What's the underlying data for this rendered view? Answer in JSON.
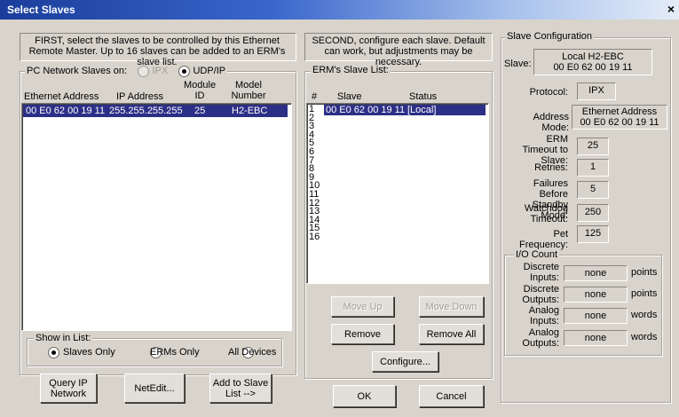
{
  "window": {
    "title": "Select Slaves",
    "close": "×"
  },
  "left": {
    "instructions": "FIRST, select the slaves to be controlled by this Ethernet Remote Master.  Up to 16 slaves can be added to an ERM's slave list.",
    "group_label": "PC Network Slaves on:",
    "radio_ipx": "IPX",
    "radio_udp": "UDP/IP",
    "columns": {
      "eth": "Ethernet Address",
      "ip": "IP Address",
      "module": "Module\nID",
      "model": "Model\nNumber"
    },
    "rows": [
      {
        "eth": "00 E0 62 00 19 11",
        "ip": "255.255.255.255",
        "module": "25",
        "model": "H2-EBC"
      }
    ],
    "show_group": "Show in List:",
    "show_options": [
      "Slaves Only",
      "ERMs Only",
      "All Devices"
    ],
    "buttons": {
      "query": "Query IP Network",
      "netedit": "NetEdit...",
      "add": "Add to Slave List -->"
    }
  },
  "middle": {
    "instructions": "SECOND, configure each slave.  Default can work, but adjustments may be necessary.",
    "group_label": "ERM's Slave List:",
    "columns": {
      "num": "#",
      "slave": "Slave",
      "status": "Status"
    },
    "row_numbers": [
      "1",
      "2",
      "3",
      "4",
      "5",
      "6",
      "7",
      "8",
      "9",
      "10",
      "11",
      "12",
      "13",
      "14",
      "15",
      "16"
    ],
    "rows": [
      {
        "slave": "00 E0 62 00 19 11",
        "status": "[Local]"
      }
    ],
    "buttons": {
      "move_up": "Move Up",
      "move_down": "Move Down",
      "remove": "Remove",
      "remove_all": "Remove All",
      "configure": "Configure...",
      "ok": "OK",
      "cancel": "Cancel"
    }
  },
  "config": {
    "group_label": "Slave Configuration",
    "slave_label": "Slave:",
    "slave_value_1": "Local  H2-EBC",
    "slave_value_2": "00 E0 62 00 19 11",
    "protocol_label": "Protocol:",
    "protocol_value": "IPX",
    "address_mode_label": "Address Mode:",
    "address_mode_value_1": "Ethernet Address",
    "address_mode_value_2": "00 E0 62 00 19 11",
    "erm_timeout_label": "ERM Timeout to Slave:",
    "erm_timeout_value": "25",
    "retries_label": "Retries:",
    "retries_value": "1",
    "failures_label": "Failures Before Standby Mode:",
    "failures_value": "5",
    "watchdog_label": "Watchdog Timeout:",
    "watchdog_value": "250",
    "pet_label": "Pet Frequency:",
    "pet_value": "125",
    "io_group": "I/O Count",
    "io": [
      {
        "label": "Discrete Inputs:",
        "value": "none",
        "unit": "points"
      },
      {
        "label": "Discrete Outputs:",
        "value": "none",
        "unit": "points"
      },
      {
        "label": "Analog Inputs:",
        "value": "none",
        "unit": "words"
      },
      {
        "label": "Analog Outputs:",
        "value": "none",
        "unit": "words"
      }
    ]
  }
}
